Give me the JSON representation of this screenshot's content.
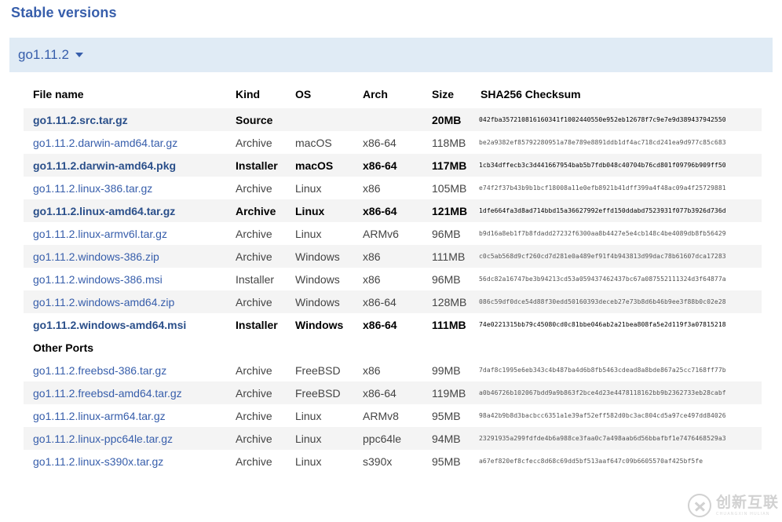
{
  "page": {
    "title": "Stable versions"
  },
  "version_selector": {
    "label": "go1.11.2",
    "caret_icon": "chevron-down-icon"
  },
  "table": {
    "headers": {
      "file_name": "File name",
      "kind": "Kind",
      "os": "OS",
      "arch": "Arch",
      "size": "Size",
      "checksum": "SHA256 Checksum"
    },
    "rows": [
      {
        "file_name": "go1.11.2.src.tar.gz",
        "kind": "Source",
        "os": "",
        "arch": "",
        "size": "20MB",
        "checksum": "042fba357210816160341f1002440550e952eb12678f7c9e7e9d389437942550",
        "highlight": true
      },
      {
        "file_name": "go1.11.2.darwin-amd64.tar.gz",
        "kind": "Archive",
        "os": "macOS",
        "arch": "x86-64",
        "size": "118MB",
        "checksum": "be2a9382ef85792280951a78e789e8891ddb1df4ac718cd241ea9d977c85c683",
        "highlight": false
      },
      {
        "file_name": "go1.11.2.darwin-amd64.pkg",
        "kind": "Installer",
        "os": "macOS",
        "arch": "x86-64",
        "size": "117MB",
        "checksum": "1cb34dffecb3c3d441667954bab5b7fdb048c40704b76cd801f09796b909ff50",
        "highlight": true
      },
      {
        "file_name": "go1.11.2.linux-386.tar.gz",
        "kind": "Archive",
        "os": "Linux",
        "arch": "x86",
        "size": "105MB",
        "checksum": "e74f2f37b43b9b1bcf18008a11e0efb8921b41dff399a4f48ac09a4f25729881",
        "highlight": false
      },
      {
        "file_name": "go1.11.2.linux-amd64.tar.gz",
        "kind": "Archive",
        "os": "Linux",
        "arch": "x86-64",
        "size": "121MB",
        "checksum": "1dfe664fa3d8ad714bbd15a36627992effd150ddabd7523931f077b3926d736d",
        "highlight": true
      },
      {
        "file_name": "go1.11.2.linux-armv6l.tar.gz",
        "kind": "Archive",
        "os": "Linux",
        "arch": "ARMv6",
        "size": "96MB",
        "checksum": "b9d16a8eb1f7b8fdadd27232f6300aa8b4427e5e4cb148c4be4089db8fb56429",
        "highlight": false
      },
      {
        "file_name": "go1.11.2.windows-386.zip",
        "kind": "Archive",
        "os": "Windows",
        "arch": "x86",
        "size": "111MB",
        "checksum": "c0c5ab568d9cf260cd7d281e0a489ef91f4b943813d99dac78b61607dca17283",
        "highlight": false
      },
      {
        "file_name": "go1.11.2.windows-386.msi",
        "kind": "Installer",
        "os": "Windows",
        "arch": "x86",
        "size": "96MB",
        "checksum": "56dc82a16747be3b94213cd53a059437462437bc67a087552111324d3f64877a",
        "highlight": false
      },
      {
        "file_name": "go1.11.2.windows-amd64.zip",
        "kind": "Archive",
        "os": "Windows",
        "arch": "x86-64",
        "size": "128MB",
        "checksum": "086c59df0dce54d88f30edd50160393deceb27e73b8d6b46b9ee3f88b0c02e28",
        "highlight": false
      },
      {
        "file_name": "go1.11.2.windows-amd64.msi",
        "kind": "Installer",
        "os": "Windows",
        "arch": "x86-64",
        "size": "111MB",
        "checksum": "74e0221315bb79c45080cd0c81bbe046ab2a21bea808fa5e2d119f3a07815218",
        "highlight": true
      }
    ],
    "other_ports_label": "Other Ports",
    "other_ports_rows": [
      {
        "file_name": "go1.11.2.freebsd-386.tar.gz",
        "kind": "Archive",
        "os": "FreeBSD",
        "arch": "x86",
        "size": "99MB",
        "checksum": "7daf8c1995e6eb343c4b487ba4d6b8fb5463cdead8a8bde867a25cc7168ff77b",
        "highlight": false
      },
      {
        "file_name": "go1.11.2.freebsd-amd64.tar.gz",
        "kind": "Archive",
        "os": "FreeBSD",
        "arch": "x86-64",
        "size": "119MB",
        "checksum": "a0b46726b102067bdd9a9b863f2bce4d23e4478118162bb9b2362733eb28cabf",
        "highlight": false
      },
      {
        "file_name": "go1.11.2.linux-arm64.tar.gz",
        "kind": "Archive",
        "os": "Linux",
        "arch": "ARMv8",
        "size": "95MB",
        "checksum": "98a42b9b8d3bacbcc6351a1e39af52eff582d0bc3ac804cd5a97ce497dd84026",
        "highlight": false
      },
      {
        "file_name": "go1.11.2.linux-ppc64le.tar.gz",
        "kind": "Archive",
        "os": "Linux",
        "arch": "ppc64le",
        "size": "94MB",
        "checksum": "23291935a299fdfde4b6a988ce3faa0c7a498aab6d56bbafbf1e7476468529a3",
        "highlight": false
      },
      {
        "file_name": "go1.11.2.linux-s390x.tar.gz",
        "kind": "Archive",
        "os": "Linux",
        "arch": "s390x",
        "size": "95MB",
        "checksum": "a67ef820ef8cfecc8d68c69dd5bf513aaf647c09b6605570af425bf5fe",
        "highlight": false
      }
    ]
  },
  "watermark": {
    "cn": "创新互联",
    "en": "CHUANGXIN HULIAN"
  },
  "colors": {
    "accent": "#375eab",
    "bar_background": "#e0ebf5",
    "stripe": "#f4f4f4"
  }
}
